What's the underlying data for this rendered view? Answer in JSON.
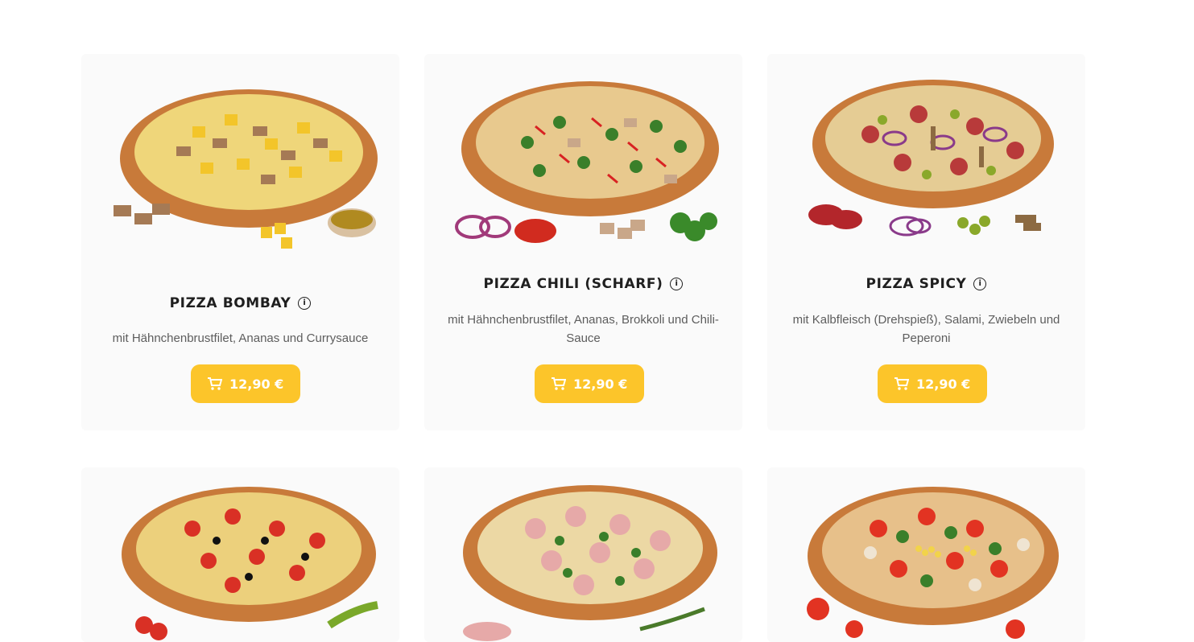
{
  "products": [
    {
      "name": "PIZZA BOMBAY",
      "description": "mit Hähnchenbrustfilet, Ananas und Currysauce",
      "price": "12,90 €",
      "info_icon": "info-icon",
      "cart_icon": "cart-icon"
    },
    {
      "name": "PIZZA CHILI (SCHARF)",
      "description": "mit Hähnchenbrustfilet, Ananas, Brokkoli und Chili-Sauce",
      "price": "12,90 €",
      "info_icon": "info-icon",
      "cart_icon": "cart-icon"
    },
    {
      "name": "PIZZA SPICY",
      "description": "mit Kalbfleisch (Drehspieß), Salami, Zwiebeln und Peperoni",
      "price": "12,90 €",
      "info_icon": "info-icon",
      "cart_icon": "cart-icon"
    },
    {
      "name": "",
      "description": "",
      "price": ""
    },
    {
      "name": "",
      "description": "",
      "price": ""
    },
    {
      "name": "",
      "description": "",
      "price": ""
    }
  ],
  "colors": {
    "button": "#fcc52a",
    "card_background": "#fafafa",
    "title": "#1f1f1f",
    "description": "#5d5d5d"
  }
}
